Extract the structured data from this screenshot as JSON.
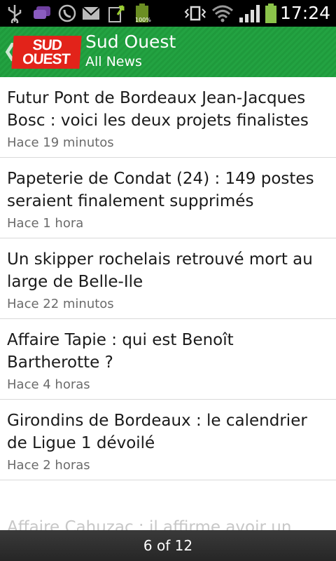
{
  "status_bar": {
    "time": "17:24",
    "battery_label": "100%",
    "icons": [
      "usb-icon",
      "chat-icon",
      "whatsapp-icon",
      "email-icon",
      "download-icon",
      "battery-small-icon",
      "vibrate-icon",
      "wifi-icon",
      "signal-icon",
      "battery-icon"
    ]
  },
  "action_bar": {
    "logo_line1": "SUD",
    "logo_line2": "OUEST",
    "title": "Sud Ouest",
    "subtitle": "All News",
    "colors": {
      "bar": "#1f9a3c",
      "logo": "#e2231a"
    }
  },
  "news": {
    "items": [
      {
        "title": "Futur Pont de Bordeaux Jean-Jacques Bosc : voici les deux projets finalistes",
        "time": "Hace 19 minutos"
      },
      {
        "title": "Papeterie de Condat (24) : 149 postes seraient finalement supprimés",
        "time": "Hace 1 hora"
      },
      {
        "title": "Un skipper rochelais retrouvé mort au large de Belle-Ile",
        "time": "Hace 22 minutos"
      },
      {
        "title": "Affaire Tapie : qui est Benoît Bartherotte ?",
        "time": "Hace 4 horas"
      },
      {
        "title": "Girondins de Bordeaux : le calendrier de Ligue 1 dévoilé",
        "time": "Hace 2 horas"
      }
    ],
    "partial_title": "Affaire Cahuzac : il affirme avoir un"
  },
  "pager": {
    "label": "6 of 12"
  }
}
